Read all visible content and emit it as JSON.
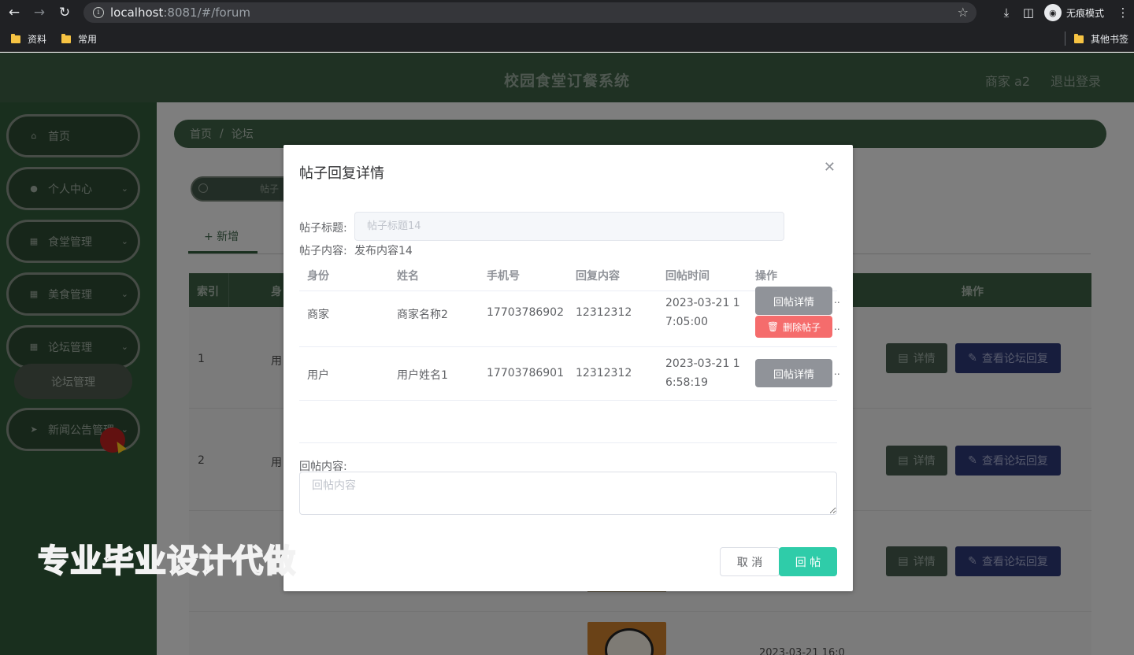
{
  "browser": {
    "url_host": "localhost",
    "url_rest": ":8081/#/forum",
    "incognito_label": "无痕模式",
    "bookmarks": [
      "资料",
      "常用"
    ],
    "other_bookmarks": "其他书签"
  },
  "header": {
    "title": "校园食堂订餐系统",
    "user": "商家 a2",
    "logout": "退出登录"
  },
  "sidebar": {
    "items": [
      {
        "label": "首页",
        "icon": "home-icon"
      },
      {
        "label": "个人中心",
        "icon": "user-icon"
      },
      {
        "label": "食堂管理",
        "icon": "grid-icon"
      },
      {
        "label": "美食管理",
        "icon": "grid-icon"
      },
      {
        "label": "论坛管理",
        "icon": "grid-icon"
      },
      {
        "label": "新闻公告管理",
        "icon": "send-icon"
      }
    ],
    "submenu_item": "论坛管理"
  },
  "breadcrumb": {
    "home": "首页",
    "current": "论坛"
  },
  "search": {
    "placeholder": "帖子"
  },
  "tabs": {
    "add": "+ 新增"
  },
  "table": {
    "headers": [
      "索引",
      "身",
      "操作"
    ],
    "rows": [
      {
        "index": "1",
        "col2": "用"
      },
      {
        "index": "2",
        "col2": "用"
      }
    ],
    "detail_btn": "详情",
    "reply_btn": "查看论坛回复",
    "partial_time": "2023-03-21 16:0"
  },
  "dialog": {
    "title": "帖子回复详情",
    "title_label": "帖子标题:",
    "title_placeholder": "帖子标题14",
    "content_label": "帖子内容:",
    "content_value": "发布内容14",
    "columns": [
      "身份",
      "姓名",
      "手机号",
      "回复内容",
      "回帖时间",
      "操作"
    ],
    "rows": [
      {
        "role": "商家",
        "name": "商家名称2",
        "phone": "17703786902",
        "content": "12312312",
        "time_line1": "2023-03-21 1",
        "time_line2": "7:05:00"
      },
      {
        "role": "用户",
        "name": "用户姓名1",
        "phone": "17703786901",
        "content": "12312312",
        "time_line1": "2023-03-21 1",
        "time_line2": "6:58:19"
      }
    ],
    "btn_reply_detail": "回帖详情",
    "btn_delete": "删除帖子",
    "reply_label": "回帖内容:",
    "reply_placeholder": "回帖内容",
    "cancel": "取 消",
    "submit": "回 帖"
  },
  "watermark": "专业毕业设计代做"
}
